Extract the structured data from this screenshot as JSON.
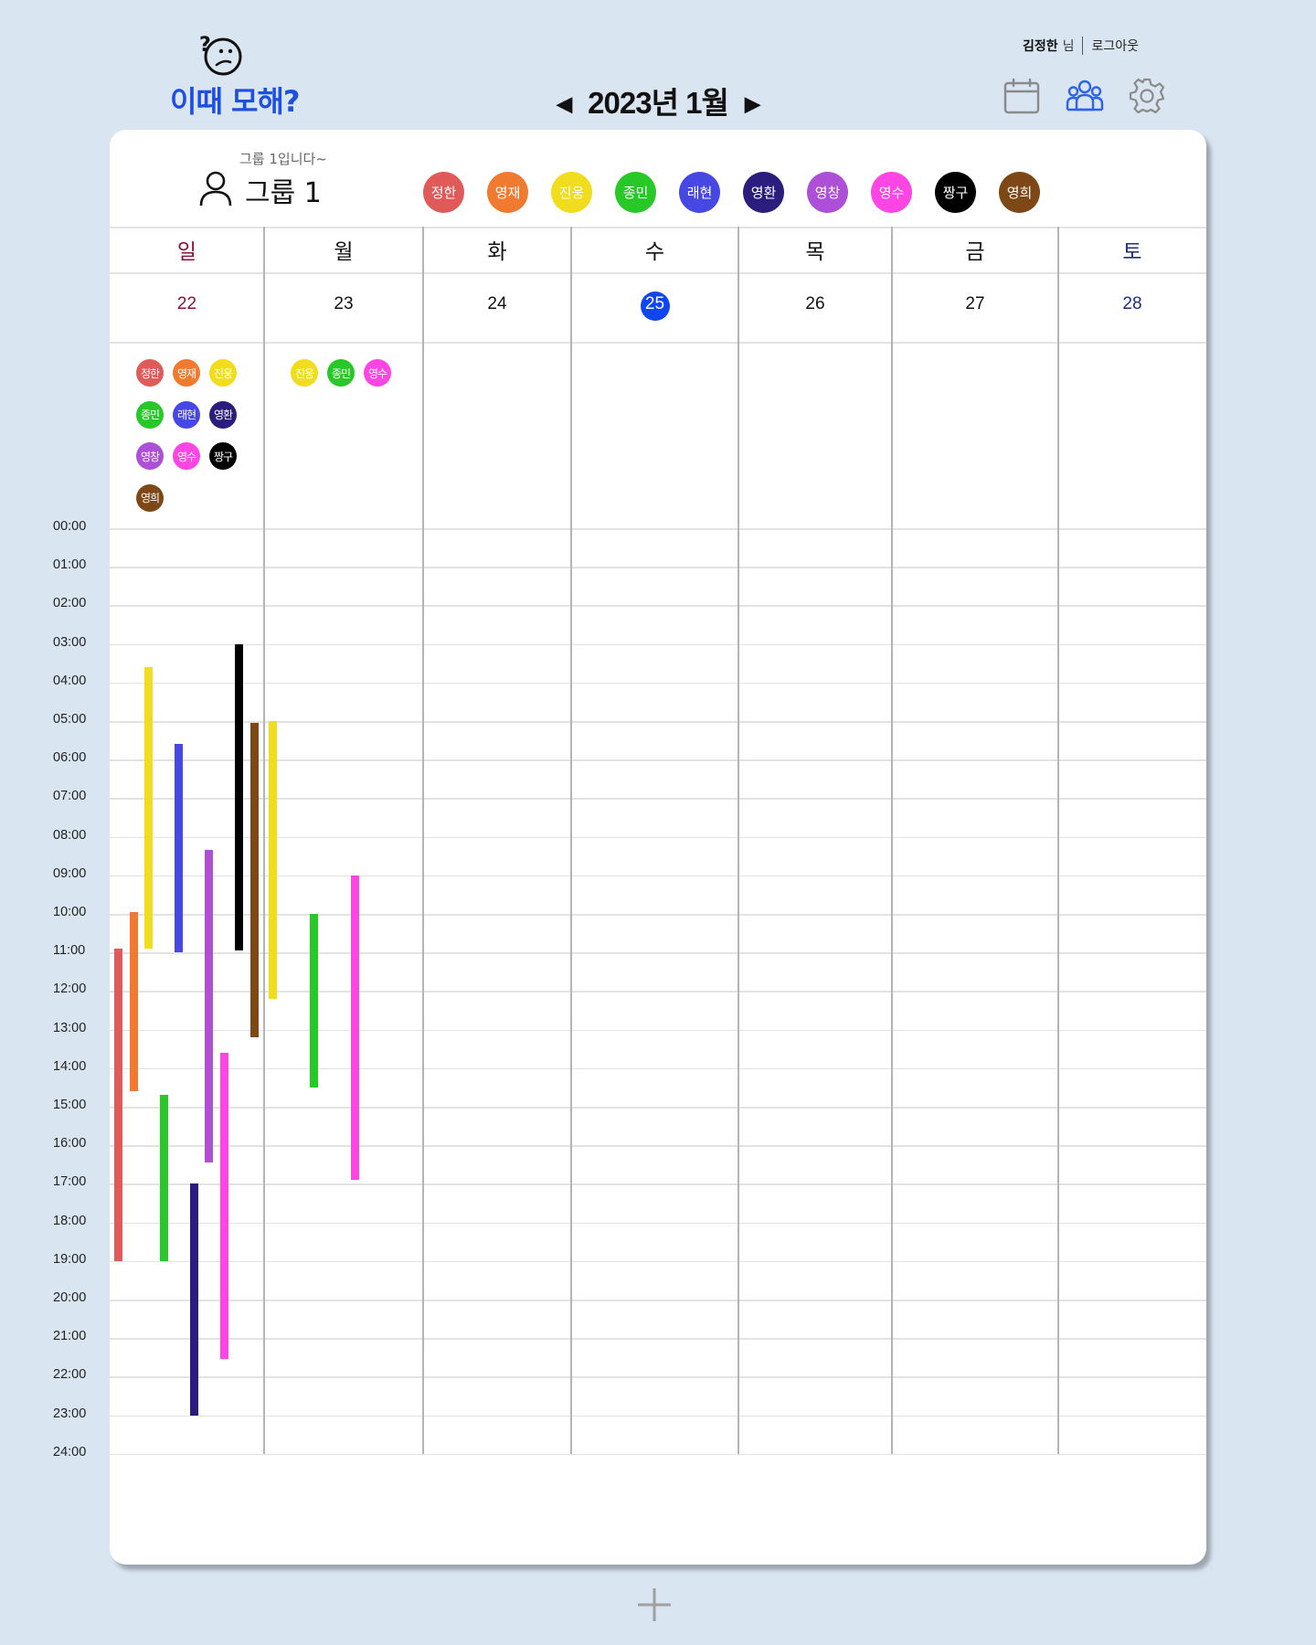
{
  "app": {
    "title": "이때 모해?"
  },
  "header": {
    "month_label": "2023년 1월",
    "prev_arrow": "◀",
    "next_arrow": "▶",
    "user_name": "김정한",
    "user_suffix": "님",
    "logout_label": "로그아웃",
    "icons": [
      "calendar-icon",
      "group-icon",
      "settings-icon"
    ]
  },
  "group": {
    "subtitle": "그룹 1입니다~",
    "name": "그룹 1"
  },
  "members": [
    {
      "name": "정한",
      "color": "#e15a5a"
    },
    {
      "name": "영재",
      "color": "#f07a30"
    },
    {
      "name": "진웅",
      "color": "#f1dc1e"
    },
    {
      "name": "종민",
      "color": "#28c828"
    },
    {
      "name": "래현",
      "color": "#4748e4"
    },
    {
      "name": "영환",
      "color": "#2b1d7e"
    },
    {
      "name": "영창",
      "color": "#ae4fd7"
    },
    {
      "name": "영수",
      "color": "#ff45e4"
    },
    {
      "name": "짱구",
      "color": "#000000"
    },
    {
      "name": "영희",
      "color": "#7d4716"
    }
  ],
  "week": {
    "day_names": [
      "일",
      "월",
      "화",
      "수",
      "목",
      "금",
      "토"
    ],
    "dates": [
      "22",
      "23",
      "24",
      "25",
      "26",
      "27",
      "28"
    ],
    "today_index": 3,
    "sunday_color": "#8a1238",
    "saturday_color": "#1d2e7b",
    "today_color": "#1046f0"
  },
  "day_members": [
    [
      "정한",
      "영재",
      "진웅",
      "종민",
      "래현",
      "영환",
      "영창",
      "영수",
      "짱구",
      "영희"
    ],
    [
      "진웅",
      "종민",
      "영수"
    ],
    [],
    [],
    [],
    [],
    []
  ],
  "time_labels": [
    "00:00",
    "01:00",
    "02:00",
    "03:00",
    "04:00",
    "05:00",
    "06:00",
    "07:00",
    "08:00",
    "09:00",
    "10:00",
    "11:00",
    "12:00",
    "13:00",
    "14:00",
    "15:00",
    "16:00",
    "17:00",
    "18:00",
    "19:00",
    "20:00",
    "21:00",
    "22:00",
    "23:00",
    "24:00"
  ],
  "schedules": [
    {
      "day": 0,
      "member": "정한",
      "start": 10.9,
      "end": 19.0
    },
    {
      "day": 0,
      "member": "영재",
      "start": 9.95,
      "end": 14.6
    },
    {
      "day": 0,
      "member": "진웅",
      "start": 3.6,
      "end": 10.9
    },
    {
      "day": 0,
      "member": "종민",
      "start": 14.7,
      "end": 19.0
    },
    {
      "day": 0,
      "member": "래현",
      "start": 5.6,
      "end": 11.0
    },
    {
      "day": 0,
      "member": "영환",
      "start": 17.0,
      "end": 23.0
    },
    {
      "day": 0,
      "member": "영창",
      "start": 8.35,
      "end": 16.45
    },
    {
      "day": 0,
      "member": "영수",
      "start": 13.6,
      "end": 21.55
    },
    {
      "day": 0,
      "member": "짱구",
      "start": 3.0,
      "end": 10.95
    },
    {
      "day": 0,
      "member": "영희",
      "start": 5.05,
      "end": 13.2
    },
    {
      "day": 1,
      "member": "진웅",
      "start": 5.0,
      "end": 12.2
    },
    {
      "day": 1,
      "member": "종민",
      "start": 10.0,
      "end": 14.5
    },
    {
      "day": 1,
      "member": "영수",
      "start": 9.0,
      "end": 16.9
    }
  ]
}
